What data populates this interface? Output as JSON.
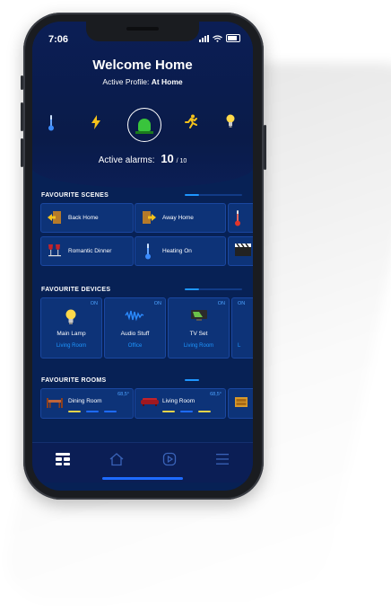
{
  "status": {
    "time": "7:06"
  },
  "header": {
    "title": "Welcome Home",
    "profile_prefix": "Active Profile:",
    "profile_value": "At Home"
  },
  "quick_icons": [
    {
      "name": "thermometer-icon"
    },
    {
      "name": "lightning-icon"
    },
    {
      "name": "alarm-siren-icon"
    },
    {
      "name": "running-man-icon"
    },
    {
      "name": "light-bulb-icon"
    }
  ],
  "alarms": {
    "label": "Active alarms:",
    "count": "10",
    "total": "/ 10"
  },
  "sections": {
    "scenes": "FAVOURITE SCENES",
    "devices": "FAVOURITE DEVICES",
    "rooms": "FAVOURITE ROOMS"
  },
  "scenes": [
    {
      "label": "Back Home"
    },
    {
      "label": "Away Home"
    },
    {
      "label": "Romantic Dinner"
    },
    {
      "label": "Heating On"
    }
  ],
  "devices": [
    {
      "name": "Main Lamp",
      "room": "Living Room",
      "state": "ON"
    },
    {
      "name": "Audio Stuff",
      "room": "Office",
      "state": "ON"
    },
    {
      "name": "TV Set",
      "room": "Living Room",
      "state": "ON"
    },
    {
      "name": "",
      "room": "L",
      "state": "ON"
    }
  ],
  "rooms": [
    {
      "name": "Dining Room",
      "temp": "68,5°"
    },
    {
      "name": "Living Room",
      "temp": "68,5°"
    }
  ],
  "colors": {
    "accent": "#1e96ff",
    "background": "#072155",
    "card": "#0d3378",
    "bar_yellow": "#e6d44a",
    "bar_blue": "#1e6bff"
  }
}
